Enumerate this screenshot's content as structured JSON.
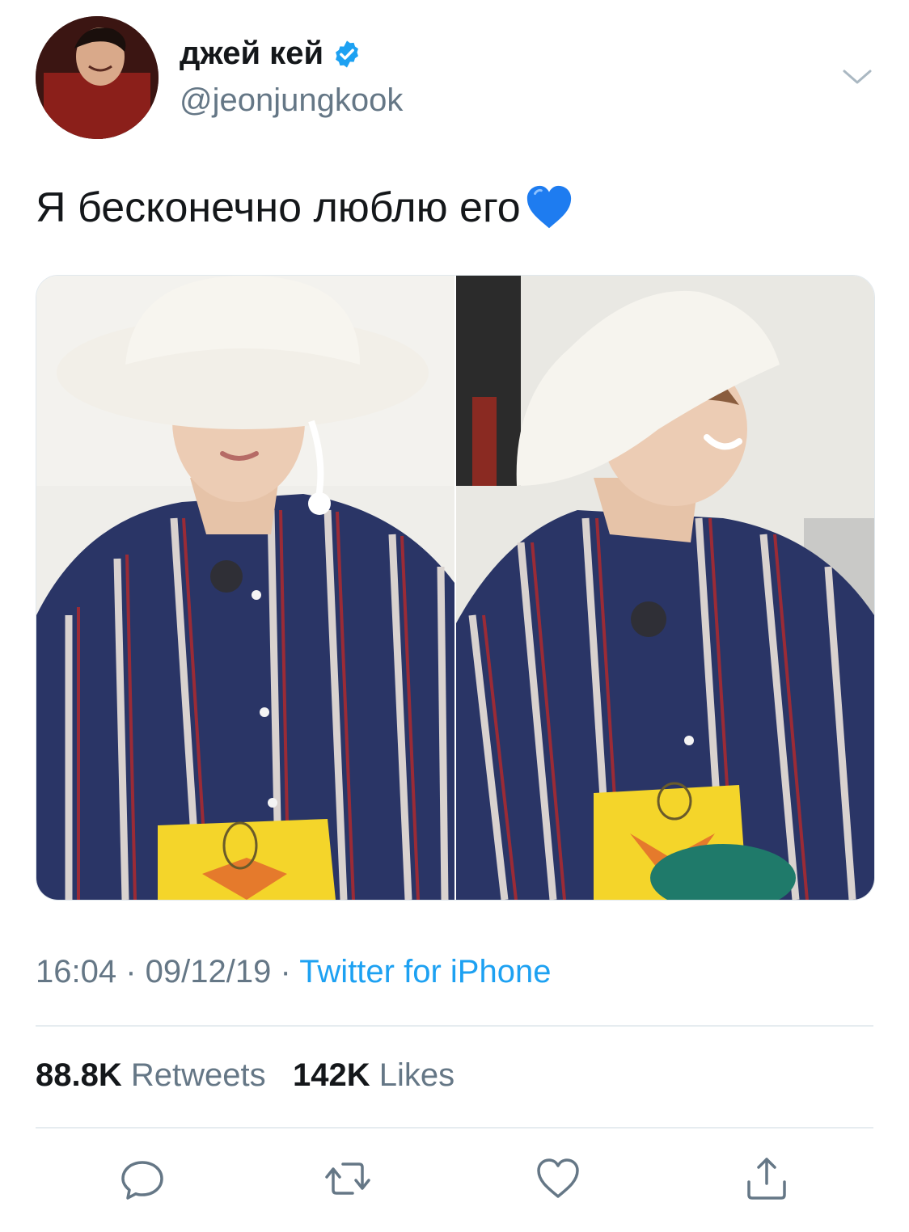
{
  "tweet": {
    "display_name": "джей кей",
    "handle": "@jeonjungkook",
    "text": "Я бесконечно люблю его",
    "emoji": "blue-heart",
    "time": "16:04",
    "date": "09/12/19",
    "separator": " · ",
    "source": "Twitter for iPhone",
    "retweets_count": "88.8K",
    "retweets_label": "Retweets",
    "likes_count": "142K",
    "likes_label": "Likes"
  },
  "icons": {
    "verified": "verified-badge-icon",
    "more": "chevron-down-icon",
    "reply": "reply-icon",
    "retweet": "retweet-icon",
    "like": "heart-icon",
    "share": "share-icon"
  },
  "colors": {
    "text": "#14171a",
    "secondary": "#657786",
    "accent": "#1da1f2",
    "divider": "#e6ecf0"
  }
}
